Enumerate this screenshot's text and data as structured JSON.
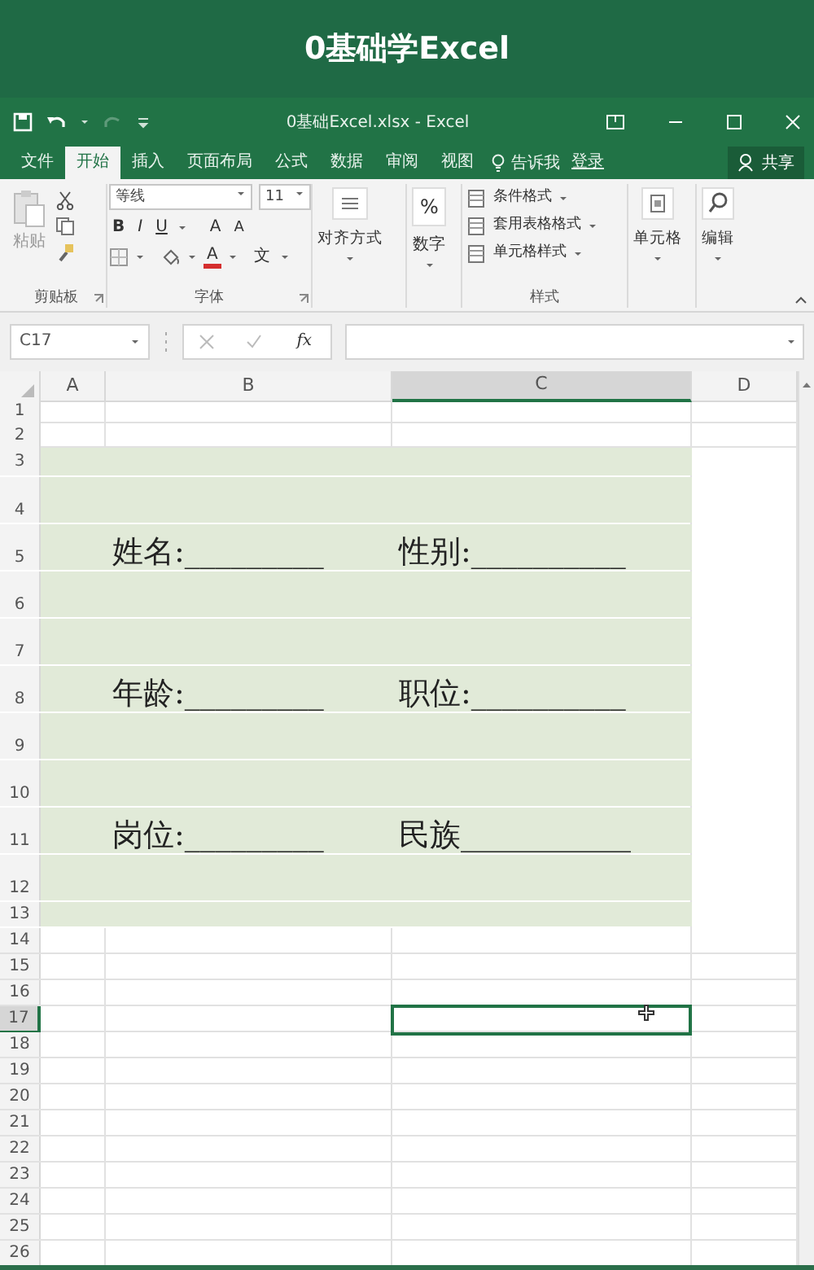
{
  "video_title": "0基础学Excel",
  "window": {
    "title": "0基础Excel.xlsx - Excel"
  },
  "tabs": [
    {
      "label": "文件",
      "selected": false
    },
    {
      "label": "开始",
      "selected": true
    },
    {
      "label": "插入",
      "selected": false
    },
    {
      "label": "页面布局",
      "selected": false
    },
    {
      "label": "公式",
      "selected": false
    },
    {
      "label": "数据",
      "selected": false
    },
    {
      "label": "审阅",
      "selected": false
    },
    {
      "label": "视图",
      "selected": false
    }
  ],
  "tell_me": "告诉我",
  "sign_in": "登录",
  "share": "共享",
  "ribbon": {
    "clipboard": {
      "paste": "粘贴",
      "label": "剪贴板"
    },
    "font": {
      "name": "等线",
      "size": "11",
      "styles": [
        "B",
        "I",
        "U"
      ],
      "grow": "A",
      "shrink": "A",
      "color_letter": "A",
      "phonetic": "文",
      "label": "字体"
    },
    "alignment": {
      "label": "对齐方式"
    },
    "number": {
      "symbol": "%",
      "label": "数字"
    },
    "styles": {
      "items": [
        "条件格式",
        "套用表格格式",
        "单元格样式"
      ],
      "label": "样式"
    },
    "cells": {
      "label": "单元格"
    },
    "editing": {
      "label": "编辑"
    }
  },
  "formula_bar": {
    "name_box": "C17",
    "function_label": "fx"
  },
  "sheet": {
    "columns": [
      {
        "label": "A",
        "selected": false
      },
      {
        "label": "B",
        "selected": false
      },
      {
        "label": "C",
        "selected": true
      },
      {
        "label": "D",
        "selected": false
      }
    ],
    "rows": [
      {
        "header": "1",
        "kind": "short",
        "shaded": false,
        "selected": false
      },
      {
        "header": "2",
        "kind": "short",
        "shaded": false,
        "selected": false
      },
      {
        "header": "3",
        "kind": "medium",
        "shaded": true,
        "selected": false
      },
      {
        "header": "4",
        "kind": "tall",
        "shaded": true,
        "selected": false
      },
      {
        "header": "5",
        "kind": "tall",
        "shaded": true,
        "selected": false,
        "column_b": "姓名:_________",
        "column_c": "性别:__________"
      },
      {
        "header": "6",
        "kind": "tall",
        "shaded": true,
        "selected": false
      },
      {
        "header": "7",
        "kind": "tall",
        "shaded": true,
        "selected": false
      },
      {
        "header": "8",
        "kind": "tall",
        "shaded": true,
        "selected": false,
        "column_b": "年龄:_________",
        "column_c": "职位:__________"
      },
      {
        "header": "9",
        "kind": "tall",
        "shaded": true,
        "selected": false
      },
      {
        "header": "10",
        "kind": "tall",
        "shaded": true,
        "selected": false
      },
      {
        "header": "11",
        "kind": "tall",
        "shaded": true,
        "selected": false,
        "column_b": "岗位:_________",
        "column_c": "民族___________"
      },
      {
        "header": "12",
        "kind": "tall",
        "shaded": true,
        "selected": false
      },
      {
        "header": "13",
        "kind": "short",
        "shaded": true,
        "selected": false
      },
      {
        "header": "14",
        "kind": "short",
        "shaded": false,
        "selected": false
      },
      {
        "header": "15",
        "kind": "short",
        "shaded": false,
        "selected": false
      },
      {
        "header": "16",
        "kind": "short",
        "shaded": false,
        "selected": false
      },
      {
        "header": "17",
        "kind": "short",
        "shaded": false,
        "selected": true
      },
      {
        "header": "18",
        "kind": "short",
        "shaded": false,
        "selected": false
      },
      {
        "header": "19",
        "kind": "short",
        "shaded": false,
        "selected": false
      },
      {
        "header": "20",
        "kind": "short",
        "shaded": false,
        "selected": false
      },
      {
        "header": "21",
        "kind": "short",
        "shaded": false,
        "selected": false
      },
      {
        "header": "22",
        "kind": "short",
        "shaded": false,
        "selected": false
      },
      {
        "header": "23",
        "kind": "short",
        "shaded": false,
        "selected": false
      },
      {
        "header": "24",
        "kind": "short",
        "shaded": false,
        "selected": false
      },
      {
        "header": "25",
        "kind": "short",
        "shaded": false,
        "selected": false
      },
      {
        "header": "26",
        "kind": "short",
        "shaded": false,
        "selected": false
      }
    ]
  }
}
